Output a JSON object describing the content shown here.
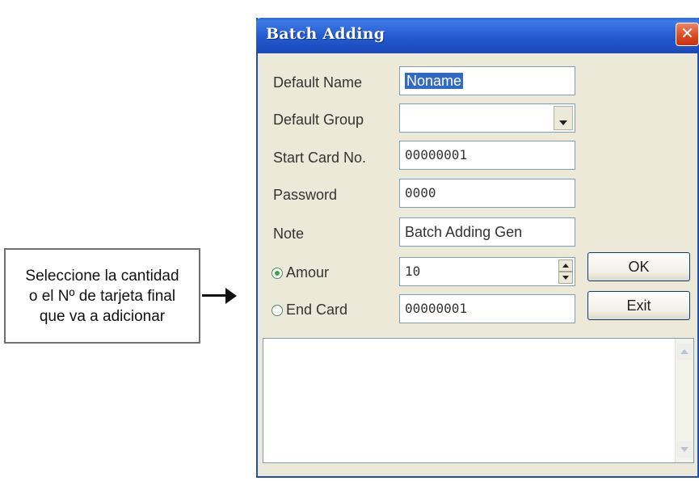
{
  "callout": {
    "lines": [
      "Seleccione la cantidad",
      "o el Nº de tarjeta final",
      "que va a adicionar"
    ]
  },
  "dialog": {
    "title": "Batch Adding",
    "close_label": "✕",
    "fields": {
      "default_name": {
        "label": "Default Name",
        "value": "Noname"
      },
      "default_group": {
        "label": "Default Group",
        "value": ""
      },
      "start_card": {
        "label": "Start Card No.",
        "value": "00000001"
      },
      "password": {
        "label": "Password",
        "value": "0000"
      },
      "note": {
        "label": "Note",
        "value": "Batch Adding Gen"
      }
    },
    "mode": {
      "amount": {
        "label": "Amour",
        "value": "10",
        "selected": true
      },
      "end_card": {
        "label": "End Card",
        "value": "00000001",
        "selected": false
      }
    },
    "buttons": {
      "ok": "OK",
      "exit": "Exit"
    },
    "icons": {
      "close": "close-icon",
      "dropdown": "chevron-down-icon",
      "spinner_up": "arrow-up-icon",
      "spinner_down": "arrow-down-icon"
    }
  }
}
